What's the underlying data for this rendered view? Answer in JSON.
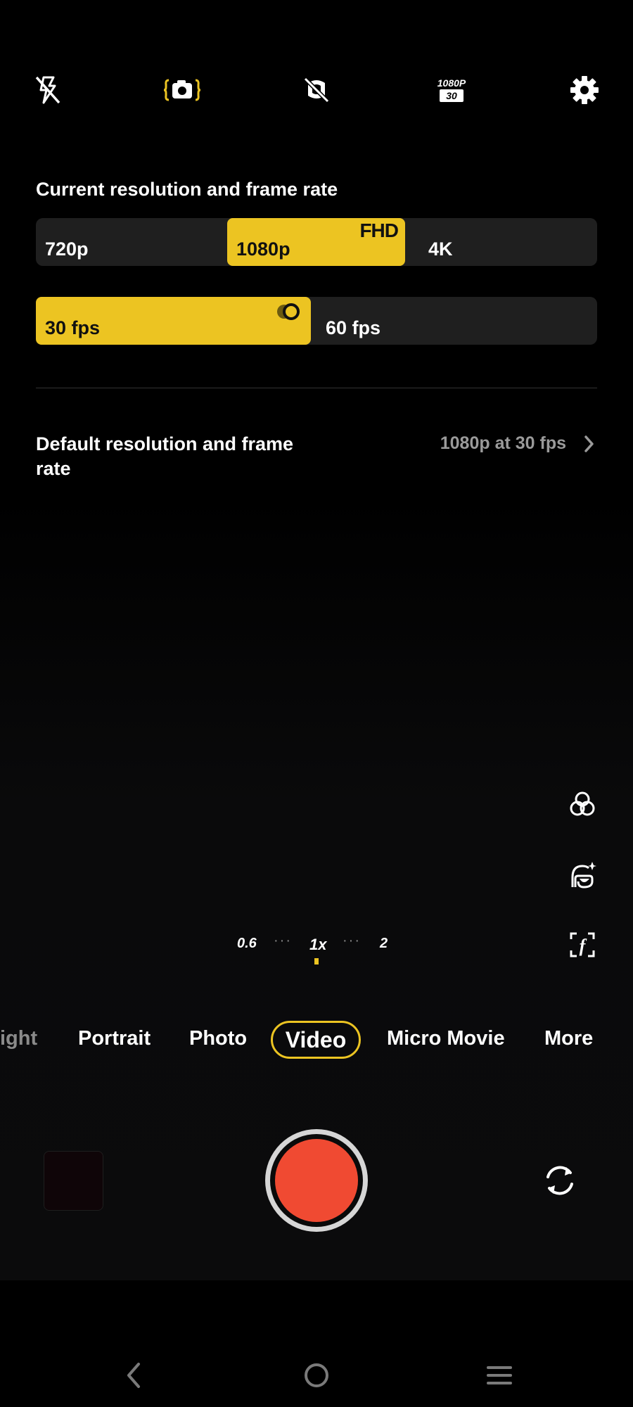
{
  "toolbar": {
    "icons": [
      "flash-off-icon",
      "live-photo-icon",
      "stabilization-off-icon",
      "resolution-badge-icon",
      "settings-icon"
    ],
    "resolution_badge": {
      "top": "1080P",
      "bottom": "30"
    },
    "accent_color": "#ecc422"
  },
  "panel": {
    "title": "Current resolution and frame rate",
    "resolutions": [
      {
        "label": "720p",
        "selected": false
      },
      {
        "label": "1080p",
        "selected": true,
        "badge": "FHD"
      },
      {
        "label": "4K",
        "selected": false
      }
    ],
    "frame_rates": [
      {
        "label": "30 fps",
        "selected": true
      },
      {
        "label": "60 fps",
        "selected": false
      }
    ],
    "default_label": "Default resolution and frame rate",
    "default_value": "1080p at 30 fps"
  },
  "side_tools": [
    "filters-icon",
    "beauty-icon",
    "framing-icon"
  ],
  "zoom": {
    "levels": [
      "0.6",
      "1x",
      "2"
    ],
    "active": "1x",
    "separator": "···"
  },
  "modes": {
    "items": [
      "ight",
      "Portrait",
      "Photo",
      "Video",
      "Micro Movie",
      "More"
    ],
    "active": "Video"
  },
  "controls": {
    "shutter_color": "#f04a32"
  },
  "nav": [
    "back-icon",
    "home-icon",
    "menu-icon"
  ]
}
